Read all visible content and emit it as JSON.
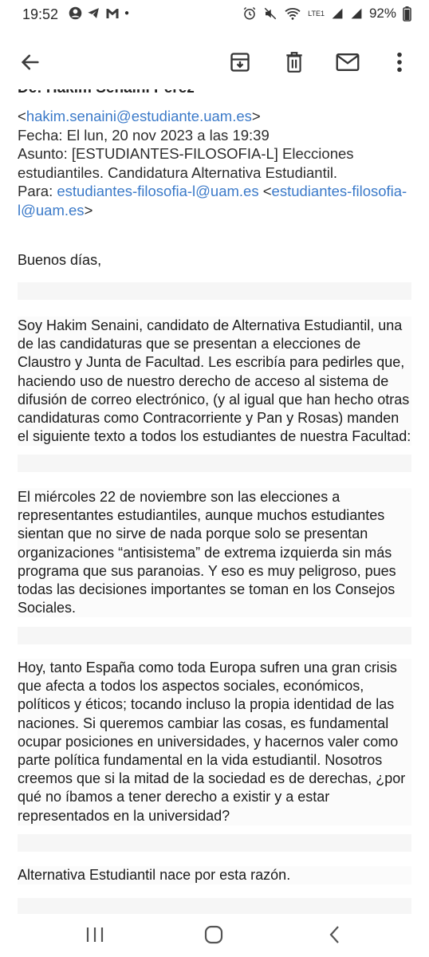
{
  "status": {
    "time": "19:52",
    "battery": "92%",
    "lte": "LTE1"
  },
  "header": {
    "from_cut": "De: Hakim Senaini Pérez",
    "email_lt": "<",
    "email": "hakim.senaini@estudiante.uam.es",
    "email_gt": ">",
    "date": "Fecha: El lun, 20 nov 2023 a las 19:39",
    "subject": "Asunto: [ESTUDIANTES-FILOSOFIA-L] Elecciones estudiantiles. Candidatura Alternativa Estudiantil.",
    "to_label": "Para: ",
    "to_link": "estudiantes-filosofia-l@uam.es",
    "to_lt": " <",
    "to_link2": "estudiantes-filosofia-l@uam.es",
    "to_gt": ">"
  },
  "body": {
    "greeting": "Buenos días,",
    "p1": "Soy Hakim Senaini, candidato de Alternativa Estudiantil, una de las candidaturas que se presentan a elecciones de Claustro y Junta de Facultad. Les escribía para pedirles que, haciendo uso de nuestro derecho de acceso al sistema de difusión de correo electrónico, (y al igual que han hecho otras candidaturas como Contracorriente y Pan y Rosas) manden el siguiente texto a todos los estudiantes de nuestra Facultad:",
    "p2": "El miércoles 22 de noviembre son las elecciones a representantes estudiantiles, aunque muchos estudiantes sientan que no sirve de nada porque solo se presentan organizaciones “antisistema” de extrema izquierda sin más programa que sus paranoias. Y eso es muy peligroso, pues todas las decisiones importantes se toman en los Consejos Sociales.",
    "p3": "Hoy, tanto España como toda Europa sufren una gran crisis que afecta a todos los aspectos sociales, económicos, políticos y éticos; tocando incluso la propia identidad de las naciones. Si queremos cambiar las cosas, es fundamental ocupar posiciones en universidades, y hacernos valer como parte política fundamental en la vida estudiantil. Nosotros creemos que si la mitad de la sociedad es de derechas, ¿por qué no íbamos a tener derecho a existir y a estar representados en la universidad?",
    "p4": "Alternativa Estudiantil nace por esta razón."
  },
  "icons": {
    "back": "arrow-back-icon",
    "archive": "archive-icon",
    "delete": "trash-icon",
    "mail": "mail-icon",
    "more": "more-vert-icon"
  }
}
